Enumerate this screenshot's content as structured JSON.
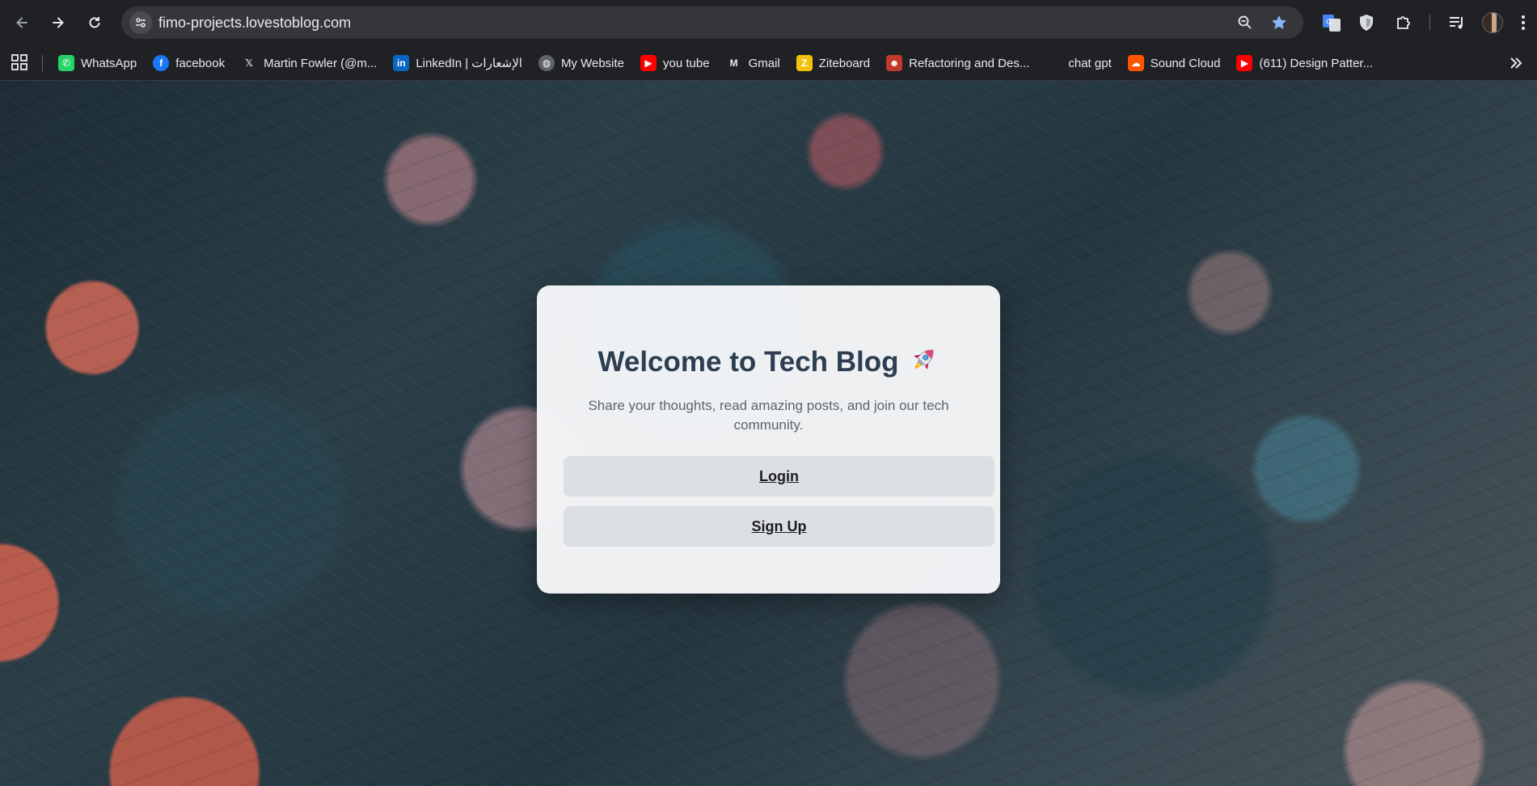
{
  "browser": {
    "url": "fimo-projects.lovestoblog.com"
  },
  "bookmarks": [
    {
      "label": "WhatsApp",
      "icon": "whatsapp-icon",
      "color": "#25d366",
      "glyph": "✆"
    },
    {
      "label": "facebook",
      "icon": "facebook-icon",
      "color": "#1877f2",
      "glyph": "f"
    },
    {
      "label": "Martin Fowler (@m...",
      "icon": "x-twitter-icon",
      "color": "#202124",
      "glyph": "𝕏"
    },
    {
      "label": "LinkedIn | الإشعارات",
      "icon": "linkedin-icon",
      "color": "#0a66c2",
      "glyph": "in"
    },
    {
      "label": "My Website",
      "icon": "globe-icon",
      "color": "#5f6368",
      "glyph": "◍"
    },
    {
      "label": "you tube",
      "icon": "youtube-icon",
      "color": "#ff0000",
      "glyph": "▶"
    },
    {
      "label": "Gmail",
      "icon": "gmail-icon",
      "color": "#202124",
      "glyph": "M"
    },
    {
      "label": "Ziteboard",
      "icon": "ziteboard-icon",
      "color": "#f4c20d",
      "glyph": "Z"
    },
    {
      "label": "Refactoring and Des...",
      "icon": "refactoring-guru-icon",
      "color": "#c0392b",
      "glyph": "☻"
    },
    {
      "label": "chat gpt",
      "icon": "chatgpt-icon",
      "color": "#202124",
      "glyph": ""
    },
    {
      "label": "Sound Cloud",
      "icon": "soundcloud-icon",
      "color": "#ff5500",
      "glyph": "☁"
    },
    {
      "label": "(611) Design Patter...",
      "icon": "youtube-icon",
      "color": "#ff0000",
      "glyph": "▶"
    }
  ],
  "card": {
    "title": "Welcome to Tech Blog",
    "title_icon": "rocket-icon",
    "subtitle": "Share your thoughts, read amazing posts, and join our tech community.",
    "login_label": "Login",
    "signup_label": "Sign Up"
  }
}
